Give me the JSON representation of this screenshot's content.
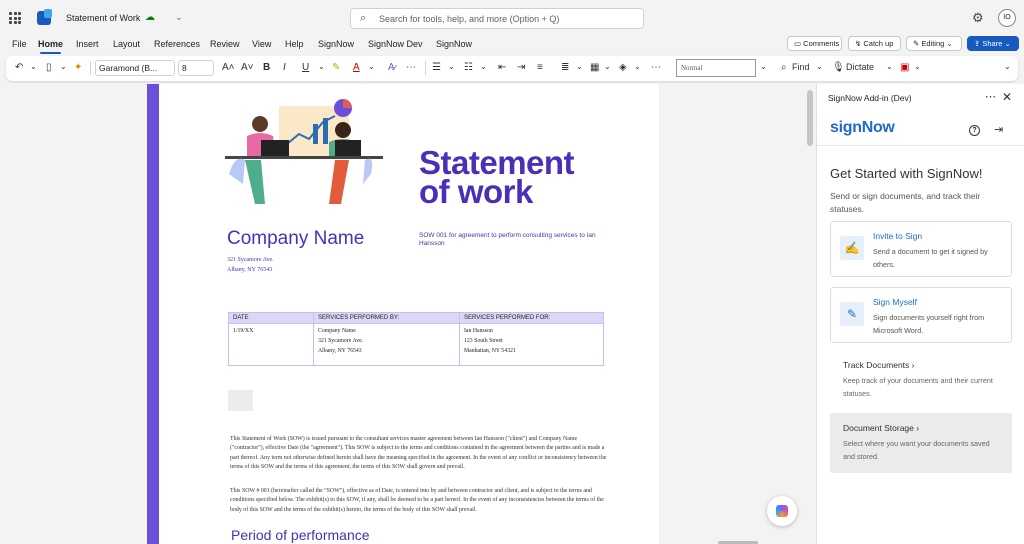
{
  "titlebar": {
    "doc_title": "Statement of Work",
    "sync_icon": "cloud-check-icon",
    "search_placeholder": "Search for tools, help, and more (Option + Q)",
    "avatar_initials": "IO"
  },
  "menu_tabs": [
    "File",
    "Home",
    "Insert",
    "Layout",
    "References",
    "Review",
    "View",
    "Help",
    "SignNow",
    "SignNow Dev",
    "SignNow"
  ],
  "active_tab": "Home",
  "actions": {
    "comments": "Comments",
    "catch_up": "Catch up",
    "editing": "Editing",
    "share": "Share"
  },
  "ribbon": {
    "font_name": "Garamond (B...",
    "font_size": "8",
    "style": "Normal",
    "find": "Find",
    "dictate": "Dictate"
  },
  "document": {
    "title_line1": "Statement",
    "title_line2": "of work",
    "company_name": "Company Name",
    "address_line1": "321 Sycamore Ave.",
    "address_line2": "Albany, NY 76543",
    "sow_line": "SOW 001 for agreement to perform consulting services to Ian Hansson",
    "table": {
      "headers": [
        "DATE",
        "SERVICES PERFORMED BY:",
        "SERVICES PERFORMED FOR:"
      ],
      "date": "1/19/XX",
      "by": [
        "Company Name",
        "321 Sycamore Ave.",
        "Albany, NY 76543"
      ],
      "for": [
        "Ian Hansson",
        "123 South Street",
        "Manhattan, NY 54321"
      ]
    },
    "para1": "This Statement of Work (SOW) is issued pursuant to the consultant services master agreement between Ian Hansson (\"client\") and Company Name (\"contractor\"), effective Date (the \"agreement\"). This SOW is subject to the terms and conditions contained in the agreement between the parties and is made a part thereof. Any term not otherwise defined herein shall have the meaning specified in the agreement. In the event of any conflict or inconsistency between the terms of this SOW and the terms of this agreement, the terms of this SOW shall govern and prevail.",
    "para2": "This SOW # 001 (hereinafter called the \"SOW\"), effective as of Date, is entered into by and between contractor and client, and is subject to the terms and conditions specified below. The exhibit(s) to this SOW, if any, shall be deemed to be a part hereof. In the event of any inconsistencies between the terms of the body of this SOW and the terms of the exhibit(s) hereto, the terms of the body of this SOW shall prevail.",
    "period_heading": "Period of performance"
  },
  "addin": {
    "pane_title": "SignNow Add-in (Dev)",
    "logo_text": "signNow",
    "heading": "Get Started with SignNow!",
    "subheading": "Send or sign documents, and track their statuses.",
    "cards": [
      {
        "title": "Invite to Sign",
        "desc": "Send a document to get it signed by others.",
        "icon": "signature-icon"
      },
      {
        "title": "Sign Myself",
        "desc": "Sign documents yourself right from Microsoft Word.",
        "icon": "sign-document-icon"
      }
    ],
    "links": [
      {
        "title": "Track Documents",
        "desc": "Keep track of your documents and their current statuses."
      },
      {
        "title": "Document Storage",
        "desc": "Select where you want your documents saved and stored."
      }
    ]
  }
}
